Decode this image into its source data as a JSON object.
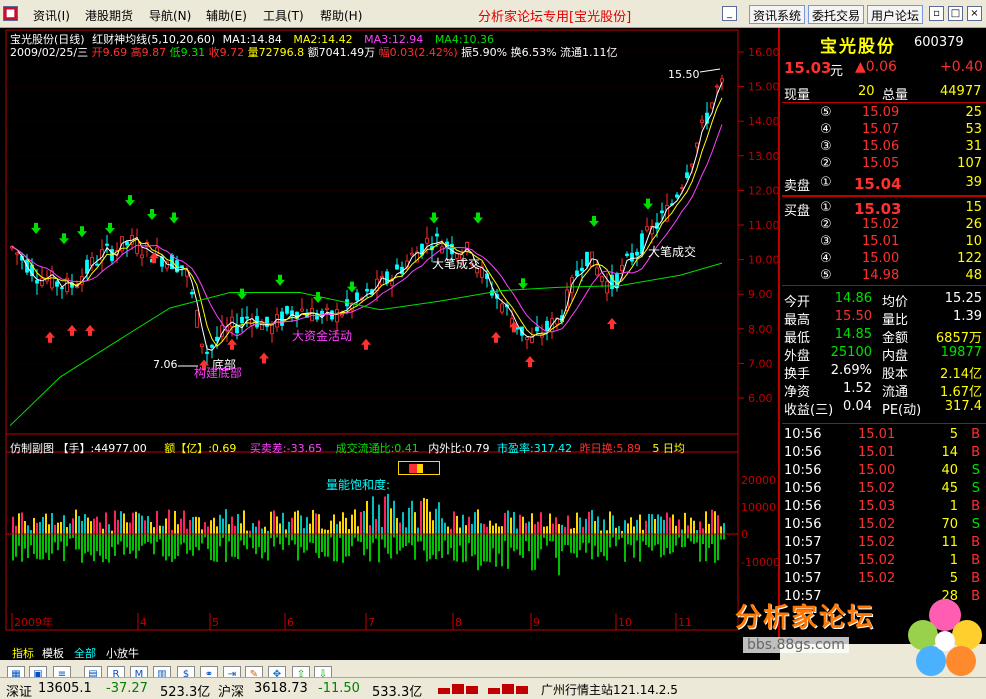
{
  "menu": {
    "items": [
      "资讯(I)",
      "港股期货",
      "导航(N)",
      "辅助(E)",
      "工具(T)",
      "帮助(H)"
    ],
    "title": "分析家论坛专用[宝光股份]",
    "buttons": [
      "资讯系统",
      "委托交易",
      "用户论坛"
    ]
  },
  "chart_header": {
    "line1": {
      "name": "宝光股份(日线)",
      "indicator": "红财神均线(5,10,20,60)",
      "ma1": "MA1:14.84",
      "ma2": "MA2:14.42",
      "ma3": "MA3:12.94",
      "ma4": "MA4:10.36"
    },
    "line2": {
      "date": "2009/02/25/三",
      "open": "开9.69",
      "high": "高9.87",
      "low": "低9.31",
      "close": "收9.72",
      "vol": "量72796.8",
      "amount": "额7041.49万",
      "range": "幅0.03(2.42%)",
      "amp": "振5.90%",
      "turnover": "换6.53%",
      "float": "流通1.11亿"
    }
  },
  "chart_data": {
    "type": "candlestick",
    "y_ticks": [
      "16.00",
      "15.00",
      "14.00",
      "13.00",
      "12.00",
      "11.00",
      "10.00",
      "9.00",
      "8.00",
      "7.00",
      "6.00"
    ],
    "month_labels": [
      "2009年",
      "4",
      "5",
      "6",
      "7",
      "8",
      "9",
      "10",
      "11"
    ],
    "annotations": {
      "high_label": "15.50",
      "low_label": "7.06",
      "bottom_text1": "底部",
      "bottom_text2": "构建底部",
      "big_deal1": "大笔成交",
      "big_deal2": "大笔成交",
      "capital": "大资金活动"
    },
    "sub_ticks": [
      "20000",
      "10000",
      "0",
      "-10000"
    ],
    "sub_header": {
      "title": "仿制副图",
      "hand": "【手】:44977.00",
      "amount": "额【亿】:0.69",
      "buysell": "买卖差:-33.65",
      "ratio": "成交流通比:0.41",
      "inout": "内外比:0.79",
      "pe": "市盈率:317.42",
      "yest": "昨日换:5.89",
      "days": "5 日均"
    },
    "saturation_label": "量能饱和度:"
  },
  "tabs": [
    "指标",
    "模板",
    "全部",
    "小放牛"
  ],
  "quote": {
    "name": "宝光股份",
    "code": "600379",
    "price": "15.03",
    "yuan": "元",
    "change": "▲0.06",
    "change2": "+0.40",
    "now_label": "现量",
    "now_vol": "20",
    "total_label": "总量",
    "total_vol": "44977",
    "sell": [
      {
        "lvl": "⑤",
        "price": "15.09",
        "vol": "25"
      },
      {
        "lvl": "④",
        "price": "15.07",
        "vol": "53"
      },
      {
        "lvl": "③",
        "price": "15.06",
        "vol": "31"
      },
      {
        "lvl": "②",
        "price": "15.05",
        "vol": "107"
      },
      {
        "lvl": "①",
        "price": "15.04",
        "vol": "39"
      }
    ],
    "sell_label": "卖盘",
    "buy_label": "买盘",
    "buy": [
      {
        "lvl": "①",
        "price": "15.03",
        "vol": "15"
      },
      {
        "lvl": "②",
        "price": "15.02",
        "vol": "26"
      },
      {
        "lvl": "③",
        "price": "15.01",
        "vol": "10"
      },
      {
        "lvl": "④",
        "price": "15.00",
        "vol": "122"
      },
      {
        "lvl": "⑤",
        "price": "14.98",
        "vol": "48"
      }
    ],
    "stats": [
      {
        "l1": "今开",
        "v1": "14.86",
        "l2": "均价",
        "v2": "15.25"
      },
      {
        "l1": "最高",
        "v1": "15.50",
        "l2": "量比",
        "v2": "1.39"
      },
      {
        "l1": "最低",
        "v1": "14.85",
        "l2": "金额",
        "v2": "6857万"
      },
      {
        "l1": "外盘",
        "v1": "25100",
        "l2": "内盘",
        "v2": "19877"
      },
      {
        "l1": "换手",
        "v1": "2.69%",
        "l2": "股本",
        "v2": "2.14亿"
      },
      {
        "l1": "净资",
        "v1": "1.52",
        "l2": "流通",
        "v2": "1.67亿"
      },
      {
        "l1": "收益(三)",
        "v1": "0.04",
        "l2": "PE(动)",
        "v2": "317.4"
      }
    ],
    "ticks": [
      {
        "t": "10:56",
        "p": "15.01",
        "v": "5",
        "s": "B"
      },
      {
        "t": "10:56",
        "p": "15.01",
        "v": "14",
        "s": "B"
      },
      {
        "t": "10:56",
        "p": "15.00",
        "v": "40",
        "s": "S"
      },
      {
        "t": "10:56",
        "p": "15.02",
        "v": "45",
        "s": "S"
      },
      {
        "t": "10:56",
        "p": "15.03",
        "v": "1",
        "s": "B"
      },
      {
        "t": "10:56",
        "p": "15.02",
        "v": "70",
        "s": "S"
      },
      {
        "t": "10:57",
        "p": "15.02",
        "v": "11",
        "s": "B"
      },
      {
        "t": "10:57",
        "p": "15.02",
        "v": "1",
        "s": "B"
      },
      {
        "t": "10:57",
        "p": "15.02",
        "v": "5",
        "s": "B"
      },
      {
        "t": "10:57",
        "p": "",
        "v": "28",
        "s": "B"
      }
    ]
  },
  "logo": {
    "text": "分析家论坛",
    "url": "bbs.88gs.com"
  },
  "status": {
    "sz_label": "深证",
    "sz_val": "13605.1",
    "sz_chg": "-37.27",
    "sz_amt": "523.3亿",
    "hs_label": "沪深",
    "hs_val": "3618.73",
    "hs_chg": "-11.50",
    "hs_amt": "533.3亿",
    "server": "广州行情主站121.14.2.5"
  }
}
